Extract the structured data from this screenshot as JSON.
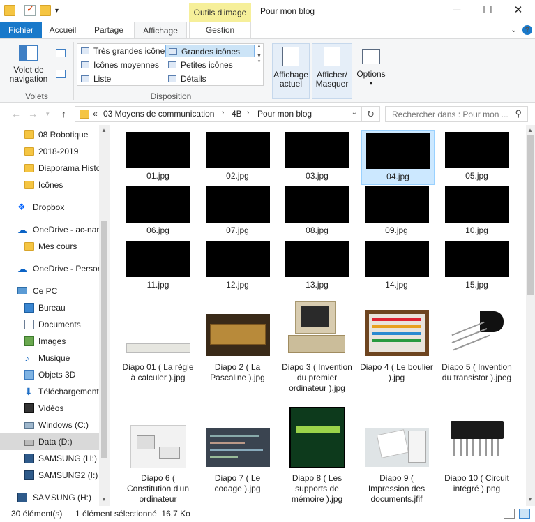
{
  "window": {
    "title": "Pour mon blog",
    "context_tab": "Outils d'image",
    "minimize": "─",
    "maximize": "☐",
    "close": "✕"
  },
  "ribbon_tabs": {
    "file": "Fichier",
    "home": "Accueil",
    "share": "Partage",
    "view": "Affichage",
    "manage": "Gestion"
  },
  "ribbon": {
    "panes": {
      "nav_pane": "Volet de\nnavigation",
      "group": "Volets"
    },
    "layout": {
      "group": "Disposition",
      "options": [
        "Très grandes icônes",
        "Grandes icônes",
        "Icônes moyennes",
        "Petites icônes",
        "Liste",
        "Détails"
      ],
      "selected": "Grandes icônes"
    },
    "current_view": "Affichage\nactuel",
    "show_hide": "Afficher/\nMasquer",
    "options": "Options"
  },
  "address": {
    "breadcrumbs": [
      "03 Moyens de communication",
      "4B",
      "Pour mon blog"
    ],
    "overflow": "«",
    "search_placeholder": "Rechercher dans : Pour mon ..."
  },
  "nav_items": [
    {
      "label": "08 Robotique",
      "icon": "folder-icon"
    },
    {
      "label": "2018-2019",
      "icon": "folder-icon"
    },
    {
      "label": "Diaporama Histo",
      "icon": "folder-icon"
    },
    {
      "label": "Icônes",
      "icon": "folder-icon"
    },
    {
      "label": "Dropbox",
      "icon": "dropbox-icon"
    },
    {
      "label": "OneDrive - ac-nar",
      "icon": "onedrive-icon"
    },
    {
      "label": "Mes cours",
      "icon": "folder-icon"
    },
    {
      "label": "OneDrive - Persor",
      "icon": "onedrive-icon"
    },
    {
      "label": "Ce PC",
      "icon": "pc-icon"
    },
    {
      "label": "Bureau",
      "icon": "desktop-icon"
    },
    {
      "label": "Documents",
      "icon": "documents-icon"
    },
    {
      "label": "Images",
      "icon": "images-icon"
    },
    {
      "label": "Musique",
      "icon": "music-icon"
    },
    {
      "label": "Objets 3D",
      "icon": "objects3d-icon"
    },
    {
      "label": "Téléchargement",
      "icon": "downloads-icon"
    },
    {
      "label": "Vidéos",
      "icon": "videos-icon"
    },
    {
      "label": "Windows (C:)",
      "icon": "windows-drive-icon"
    },
    {
      "label": "Data (D:)",
      "icon": "drive-icon"
    },
    {
      "label": "SAMSUNG (H:)",
      "icon": "usb-drive-icon"
    },
    {
      "label": "SAMSUNG2 (I:)",
      "icon": "usb-drive-icon"
    },
    {
      "label": "SAMSUNG (H:)",
      "icon": "usb-drive-icon"
    }
  ],
  "nav_selected": "Data (D:)",
  "files": [
    "01.jpg",
    "02.jpg",
    "03.jpg",
    "04.jpg",
    "05.jpg",
    "06.jpg",
    "07.jpg",
    "08.jpg",
    "09.jpg",
    "10.jpg",
    "11.jpg",
    "12.jpg",
    "13.jpg",
    "14.jpg",
    "15.jpg",
    "Diapo 01 ( La règle à calculer ).jpg",
    "Diapo 2 ( La Pascaline ).jpg",
    "Diapo 3 ( Invention du premier ordinateur ).jpg",
    "Diapo 4 ( Le boulier ).jpg",
    "Diapo 5 ( Invention du transistor ).jpeg",
    "Diapo 6 ( Constitution d'un ordinateur",
    "Diapo 7 ( Le codage ).jpg",
    "Diapo 8 ( Les supports de mémoire ).jpg",
    "Diapo 9 ( Impression des documents.jfif",
    "Diapo 10 ( Circuit intégré ).png"
  ],
  "selected_file": "04.jpg",
  "status": {
    "count": "30 élément(s)",
    "selection": "1 élément sélectionné  16,7 Ko"
  }
}
